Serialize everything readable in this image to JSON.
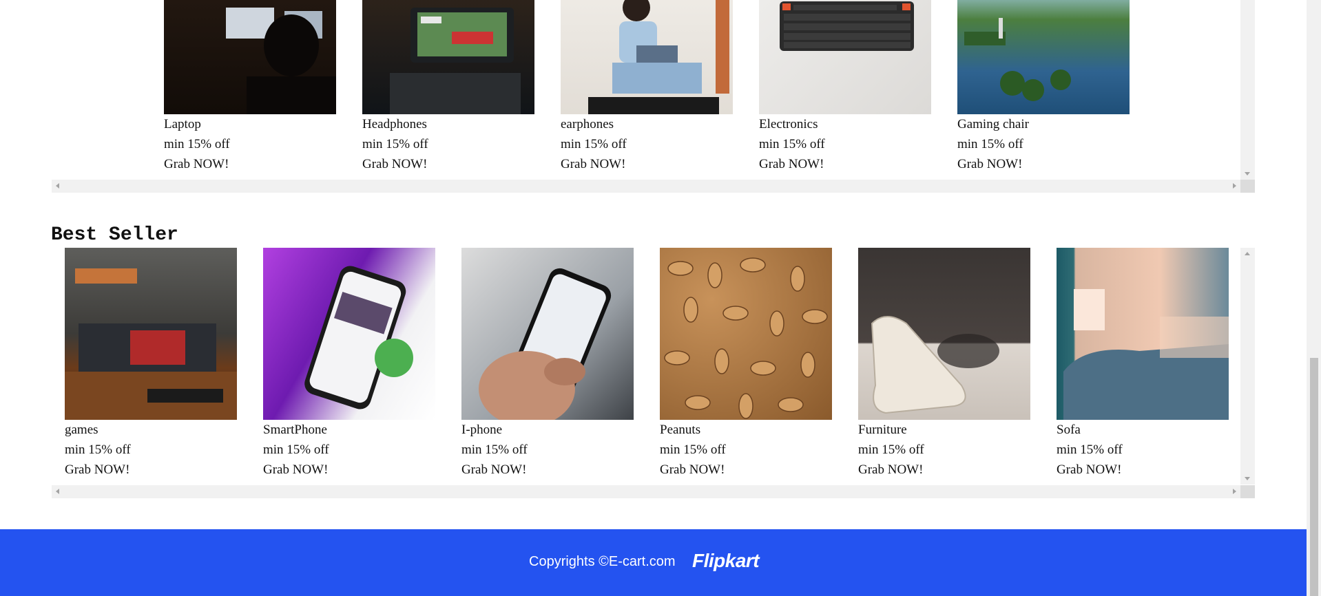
{
  "top_row": {
    "items": [
      {
        "name": "Laptop",
        "offer": "min 15% off",
        "cta": "Grab NOW!"
      },
      {
        "name": "Headphones",
        "offer": "min 15% off",
        "cta": "Grab NOW!"
      },
      {
        "name": "earphones",
        "offer": "min 15% off",
        "cta": "Grab NOW!"
      },
      {
        "name": "Electronics",
        "offer": "min 15% off",
        "cta": "Grab NOW!"
      },
      {
        "name": "Gaming chair",
        "offer": "min 15% off",
        "cta": "Grab NOW!"
      }
    ]
  },
  "best_seller": {
    "title": "Best Seller",
    "items": [
      {
        "name": "games",
        "offer": "min 15% off",
        "cta": "Grab NOW!"
      },
      {
        "name": "SmartPhone",
        "offer": "min 15% off",
        "cta": "Grab NOW!"
      },
      {
        "name": "I-phone",
        "offer": "min 15% off",
        "cta": "Grab NOW!"
      },
      {
        "name": "Peanuts",
        "offer": "min 15% off",
        "cta": "Grab NOW!"
      },
      {
        "name": "Furniture",
        "offer": "min 15% off",
        "cta": "Grab NOW!"
      },
      {
        "name": "Sofa",
        "offer": "min 15% off",
        "cta": "Grab NOW!"
      }
    ]
  },
  "footer": {
    "copyright": "Copyrights ©E-cart.com",
    "brand": "Flipkart"
  }
}
